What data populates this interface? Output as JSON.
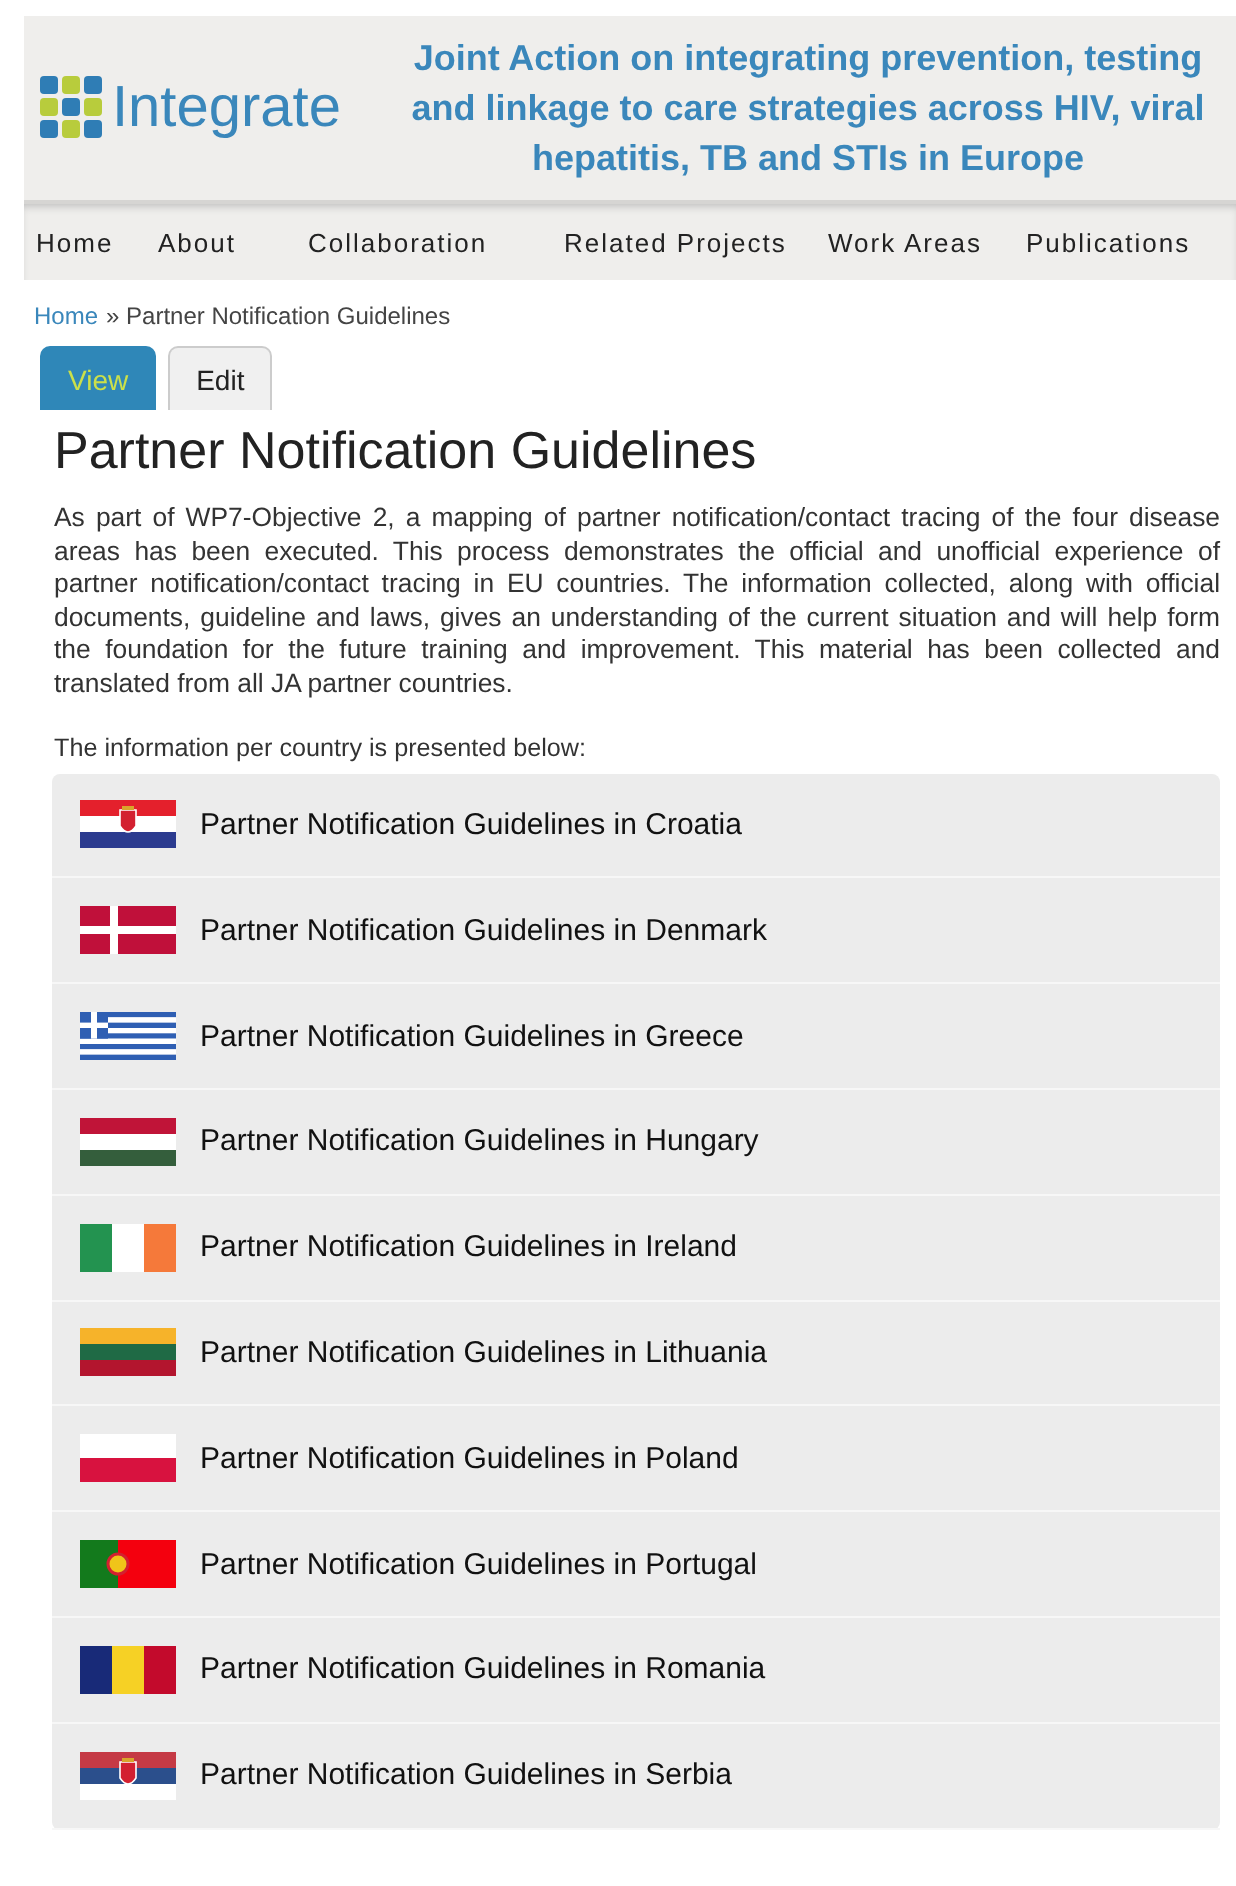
{
  "header": {
    "logo_text": "Integrate",
    "tagline": "Joint Action on integrating prevention, testing and linkage to care strategies across HIV, viral hepatitis, TB and STIs in Europe"
  },
  "nav": [
    "Home",
    "About",
    "Collaboration",
    "Related Projects",
    "Work Areas",
    "Publications"
  ],
  "breadcrumb": {
    "link": "Home",
    "separator": "»",
    "current": "Partner Notification Guidelines"
  },
  "tabs": [
    {
      "label": "View",
      "selected": true
    },
    {
      "label": "Edit",
      "selected": false
    }
  ],
  "title": "Partner Notification Guidelines",
  "intro": "As part of WP7-Objective 2, a mapping of partner notification/contact tracing of the four disease areas has been executed. This process demonstrates the official and unofficial experience of partner notification/contact tracing in EU countries. The information collected, along with official documents, guideline and laws, gives an understanding of the current situation and will help form the foundation for the future training and improvement. This material has been collected and translated from all JA partner countries.",
  "list_intro": "The information per country is presented below:",
  "countries": [
    {
      "label": "Partner Notification Guidelines in Croatia"
    },
    {
      "label": "Partner Notification Guidelines in Denmark"
    },
    {
      "label": "Partner Notification Guidelines in Greece"
    },
    {
      "label": "Partner Notification Guidelines in Hungary"
    },
    {
      "label": "Partner Notification Guidelines in Ireland"
    },
    {
      "label": "Partner Notification Guidelines in Lithuania"
    },
    {
      "label": "Partner Notification Guidelines in Poland"
    },
    {
      "label": "Partner Notification Guidelines in Portugal"
    },
    {
      "label": "Partner Notification Guidelines in Romania"
    },
    {
      "label": "Partner Notification Guidelines in Serbia"
    }
  ]
}
